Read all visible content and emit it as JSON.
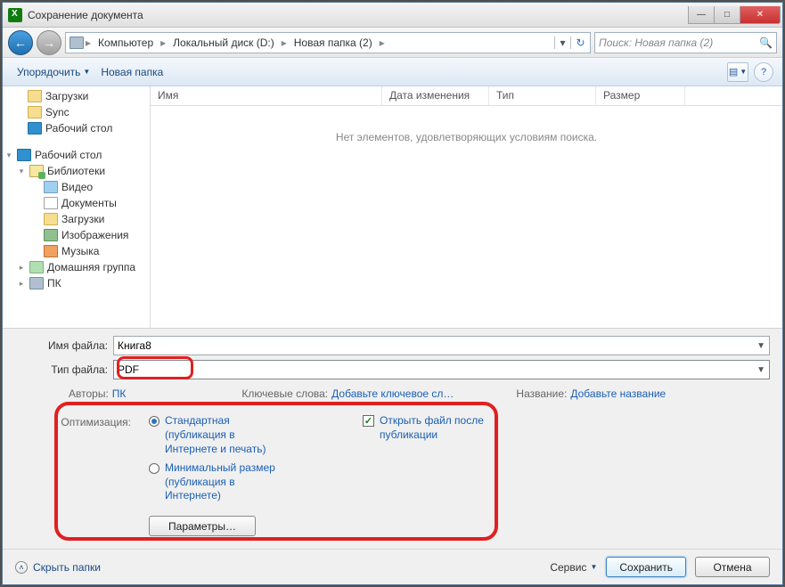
{
  "title": "Сохранение документа",
  "window_buttons": {
    "min": "—",
    "max": "□",
    "close": "✕"
  },
  "nav": {
    "back": "←",
    "forward": "→",
    "path": [
      "Компьютер",
      "Локальный диск (D:)",
      "Новая папка (2)"
    ],
    "sep": "▸",
    "dropdown": "▾",
    "refresh": "↻"
  },
  "search": {
    "placeholder": "Поиск: Новая папка (2)",
    "icon": "🔍"
  },
  "toolbar": {
    "organize": "Упорядочить",
    "newfolder": "Новая папка",
    "view_icon": "▤",
    "help_icon": "?"
  },
  "tree": [
    {
      "lvl": 1,
      "icon": "folder",
      "label": "Загрузки"
    },
    {
      "lvl": 1,
      "icon": "folder",
      "label": "Sync"
    },
    {
      "lvl": 1,
      "icon": "desktop",
      "label": "Рабочий стол"
    },
    {
      "lvl": 0,
      "icon": "desktop",
      "label": "Рабочий стол",
      "expand": "▾"
    },
    {
      "lvl": 1,
      "icon": "lib",
      "label": "Библиотеки",
      "expand": "▾"
    },
    {
      "lvl": 2,
      "icon": "video",
      "label": "Видео"
    },
    {
      "lvl": 2,
      "icon": "doc",
      "label": "Документы"
    },
    {
      "lvl": 2,
      "icon": "folder",
      "label": "Загрузки"
    },
    {
      "lvl": 2,
      "icon": "pic",
      "label": "Изображения"
    },
    {
      "lvl": 2,
      "icon": "music",
      "label": "Музыка"
    },
    {
      "lvl": 1,
      "icon": "home",
      "label": "Домашняя группа",
      "expand": "▸"
    },
    {
      "lvl": 1,
      "icon": "pc",
      "label": "ПК",
      "expand": "▸"
    }
  ],
  "columns": {
    "name": "Имя",
    "date": "Дата изменения",
    "type": "Тип",
    "size": "Размер"
  },
  "empty": "Нет элементов, удовлетворяющих условиям поиска.",
  "form": {
    "filename_label": "Имя файла:",
    "filename_value": "Книга8",
    "filetype_label": "Тип файла:",
    "filetype_value": "PDF"
  },
  "meta": {
    "authors_label": "Авторы:",
    "authors_value": "ПК",
    "keywords_label": "Ключевые слова:",
    "keywords_value": "Добавьте ключевое сл…",
    "title_label": "Название:",
    "title_value": "Добавьте название"
  },
  "optimize": {
    "label": "Оптимизация:",
    "standard": "Стандартная (публикация в Интернете и печать)",
    "minimal": "Минимальный размер (публикация в Интернете)",
    "open_after": "Открыть файл после публикации",
    "params_btn": "Параметры…"
  },
  "footer": {
    "hide_folders": "Скрыть папки",
    "service": "Сервис",
    "save": "Сохранить",
    "cancel": "Отмена"
  }
}
